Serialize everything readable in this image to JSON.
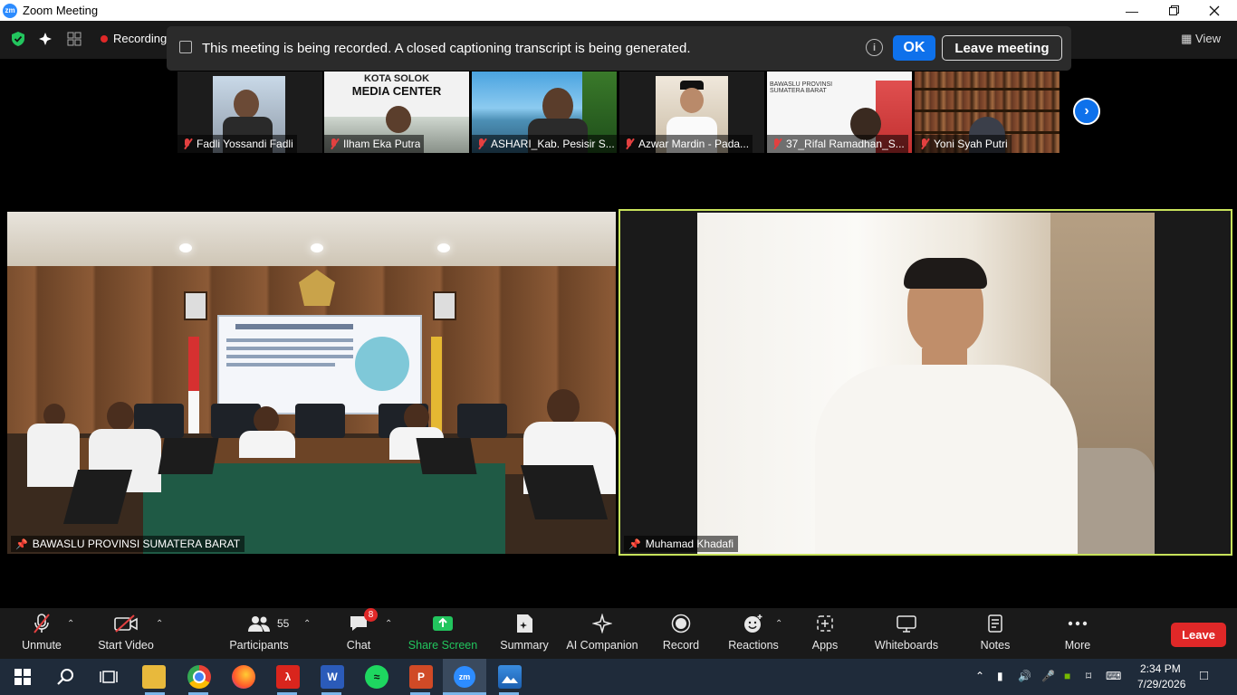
{
  "window": {
    "app_logo": "zm",
    "title": "Zoom Meeting",
    "controls": [
      "minimize-icon",
      "restore-icon",
      "close-icon"
    ]
  },
  "top_bar": {
    "recording_label": "Recording",
    "view_label": "View",
    "icons": [
      "shield-check-icon",
      "sparkle-icon",
      "grid-icon",
      "record-dot-icon"
    ]
  },
  "banner": {
    "text": "This meeting is being recorded. A closed captioning transcript is being generated.",
    "info_glyph": "i",
    "ok_label": "OK",
    "leave_label": "Leave meeting"
  },
  "thumbnails": [
    {
      "name": "Fadli Yossandi Fadli",
      "muted": true
    },
    {
      "name": "Ilham Eka Putra",
      "muted": true,
      "overlay_title": "KOTA SOLOK",
      "overlay_subtitle": "MEDIA CENTER"
    },
    {
      "name": "ASHARI_Kab. Pesisir S...",
      "muted": true
    },
    {
      "name": "Azwar Mardin - Pada...",
      "muted": true
    },
    {
      "name": "37_Rifal Ramadhan_S...",
      "muted": true,
      "overlay_subtitle": "BAWASLU PROVINSI SUMATERA BARAT"
    },
    {
      "name": "Yoni Syah Putri",
      "muted": true
    }
  ],
  "next_page_glyph": "›",
  "videos": {
    "left": {
      "name": "BAWASLU PROVINSI SUMATERA BARAT"
    },
    "right": {
      "name": "Muhamad Khadafi"
    }
  },
  "toolbar": {
    "unmute": "Unmute",
    "start_video": "Start Video",
    "participants": "Participants",
    "participants_count": "55",
    "chat": "Chat",
    "chat_badge": "8",
    "share_screen": "Share Screen",
    "summary": "Summary",
    "ai_companion": "AI Companion",
    "record": "Record",
    "reactions": "Reactions",
    "apps": "Apps",
    "whiteboards": "Whiteboards",
    "notes": "Notes",
    "more": "More",
    "leave": "Leave",
    "share_color": "#22c55e",
    "leave_color": "#e02828"
  },
  "taskbar": {
    "apps": [
      "windows-start",
      "search",
      "task-view",
      "file-explorer",
      "chrome",
      "firefox",
      "acrobat",
      "word",
      "spotify",
      "powerpoint",
      "zoom",
      "photos"
    ],
    "time": "2:34 PM",
    "date": "7/29/2026"
  }
}
